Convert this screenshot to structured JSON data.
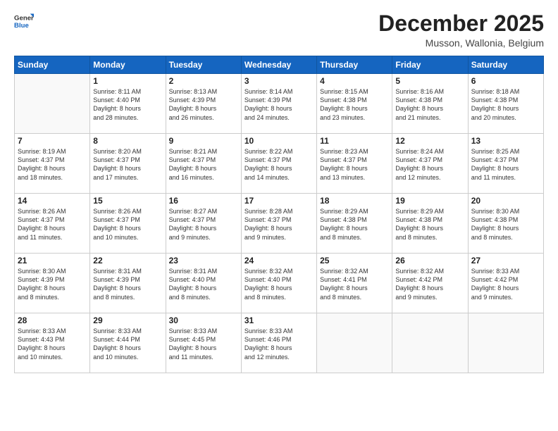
{
  "logo": {
    "general": "General",
    "blue": "Blue"
  },
  "header": {
    "month": "December 2025",
    "location": "Musson, Wallonia, Belgium"
  },
  "days": [
    "Sunday",
    "Monday",
    "Tuesday",
    "Wednesday",
    "Thursday",
    "Friday",
    "Saturday"
  ],
  "weeks": [
    [
      {
        "num": "",
        "lines": []
      },
      {
        "num": "1",
        "lines": [
          "Sunrise: 8:11 AM",
          "Sunset: 4:40 PM",
          "Daylight: 8 hours",
          "and 28 minutes."
        ]
      },
      {
        "num": "2",
        "lines": [
          "Sunrise: 8:13 AM",
          "Sunset: 4:39 PM",
          "Daylight: 8 hours",
          "and 26 minutes."
        ]
      },
      {
        "num": "3",
        "lines": [
          "Sunrise: 8:14 AM",
          "Sunset: 4:39 PM",
          "Daylight: 8 hours",
          "and 24 minutes."
        ]
      },
      {
        "num": "4",
        "lines": [
          "Sunrise: 8:15 AM",
          "Sunset: 4:38 PM",
          "Daylight: 8 hours",
          "and 23 minutes."
        ]
      },
      {
        "num": "5",
        "lines": [
          "Sunrise: 8:16 AM",
          "Sunset: 4:38 PM",
          "Daylight: 8 hours",
          "and 21 minutes."
        ]
      },
      {
        "num": "6",
        "lines": [
          "Sunrise: 8:18 AM",
          "Sunset: 4:38 PM",
          "Daylight: 8 hours",
          "and 20 minutes."
        ]
      }
    ],
    [
      {
        "num": "7",
        "lines": [
          "Sunrise: 8:19 AM",
          "Sunset: 4:37 PM",
          "Daylight: 8 hours",
          "and 18 minutes."
        ]
      },
      {
        "num": "8",
        "lines": [
          "Sunrise: 8:20 AM",
          "Sunset: 4:37 PM",
          "Daylight: 8 hours",
          "and 17 minutes."
        ]
      },
      {
        "num": "9",
        "lines": [
          "Sunrise: 8:21 AM",
          "Sunset: 4:37 PM",
          "Daylight: 8 hours",
          "and 16 minutes."
        ]
      },
      {
        "num": "10",
        "lines": [
          "Sunrise: 8:22 AM",
          "Sunset: 4:37 PM",
          "Daylight: 8 hours",
          "and 14 minutes."
        ]
      },
      {
        "num": "11",
        "lines": [
          "Sunrise: 8:23 AM",
          "Sunset: 4:37 PM",
          "Daylight: 8 hours",
          "and 13 minutes."
        ]
      },
      {
        "num": "12",
        "lines": [
          "Sunrise: 8:24 AM",
          "Sunset: 4:37 PM",
          "Daylight: 8 hours",
          "and 12 minutes."
        ]
      },
      {
        "num": "13",
        "lines": [
          "Sunrise: 8:25 AM",
          "Sunset: 4:37 PM",
          "Daylight: 8 hours",
          "and 11 minutes."
        ]
      }
    ],
    [
      {
        "num": "14",
        "lines": [
          "Sunrise: 8:26 AM",
          "Sunset: 4:37 PM",
          "Daylight: 8 hours",
          "and 11 minutes."
        ]
      },
      {
        "num": "15",
        "lines": [
          "Sunrise: 8:26 AM",
          "Sunset: 4:37 PM",
          "Daylight: 8 hours",
          "and 10 minutes."
        ]
      },
      {
        "num": "16",
        "lines": [
          "Sunrise: 8:27 AM",
          "Sunset: 4:37 PM",
          "Daylight: 8 hours",
          "and 9 minutes."
        ]
      },
      {
        "num": "17",
        "lines": [
          "Sunrise: 8:28 AM",
          "Sunset: 4:37 PM",
          "Daylight: 8 hours",
          "and 9 minutes."
        ]
      },
      {
        "num": "18",
        "lines": [
          "Sunrise: 8:29 AM",
          "Sunset: 4:38 PM",
          "Daylight: 8 hours",
          "and 8 minutes."
        ]
      },
      {
        "num": "19",
        "lines": [
          "Sunrise: 8:29 AM",
          "Sunset: 4:38 PM",
          "Daylight: 8 hours",
          "and 8 minutes."
        ]
      },
      {
        "num": "20",
        "lines": [
          "Sunrise: 8:30 AM",
          "Sunset: 4:38 PM",
          "Daylight: 8 hours",
          "and 8 minutes."
        ]
      }
    ],
    [
      {
        "num": "21",
        "lines": [
          "Sunrise: 8:30 AM",
          "Sunset: 4:39 PM",
          "Daylight: 8 hours",
          "and 8 minutes."
        ]
      },
      {
        "num": "22",
        "lines": [
          "Sunrise: 8:31 AM",
          "Sunset: 4:39 PM",
          "Daylight: 8 hours",
          "and 8 minutes."
        ]
      },
      {
        "num": "23",
        "lines": [
          "Sunrise: 8:31 AM",
          "Sunset: 4:40 PM",
          "Daylight: 8 hours",
          "and 8 minutes."
        ]
      },
      {
        "num": "24",
        "lines": [
          "Sunrise: 8:32 AM",
          "Sunset: 4:40 PM",
          "Daylight: 8 hours",
          "and 8 minutes."
        ]
      },
      {
        "num": "25",
        "lines": [
          "Sunrise: 8:32 AM",
          "Sunset: 4:41 PM",
          "Daylight: 8 hours",
          "and 8 minutes."
        ]
      },
      {
        "num": "26",
        "lines": [
          "Sunrise: 8:32 AM",
          "Sunset: 4:42 PM",
          "Daylight: 8 hours",
          "and 9 minutes."
        ]
      },
      {
        "num": "27",
        "lines": [
          "Sunrise: 8:33 AM",
          "Sunset: 4:42 PM",
          "Daylight: 8 hours",
          "and 9 minutes."
        ]
      }
    ],
    [
      {
        "num": "28",
        "lines": [
          "Sunrise: 8:33 AM",
          "Sunset: 4:43 PM",
          "Daylight: 8 hours",
          "and 10 minutes."
        ]
      },
      {
        "num": "29",
        "lines": [
          "Sunrise: 8:33 AM",
          "Sunset: 4:44 PM",
          "Daylight: 8 hours",
          "and 10 minutes."
        ]
      },
      {
        "num": "30",
        "lines": [
          "Sunrise: 8:33 AM",
          "Sunset: 4:45 PM",
          "Daylight: 8 hours",
          "and 11 minutes."
        ]
      },
      {
        "num": "31",
        "lines": [
          "Sunrise: 8:33 AM",
          "Sunset: 4:46 PM",
          "Daylight: 8 hours",
          "and 12 minutes."
        ]
      },
      {
        "num": "",
        "lines": []
      },
      {
        "num": "",
        "lines": []
      },
      {
        "num": "",
        "lines": []
      }
    ]
  ]
}
